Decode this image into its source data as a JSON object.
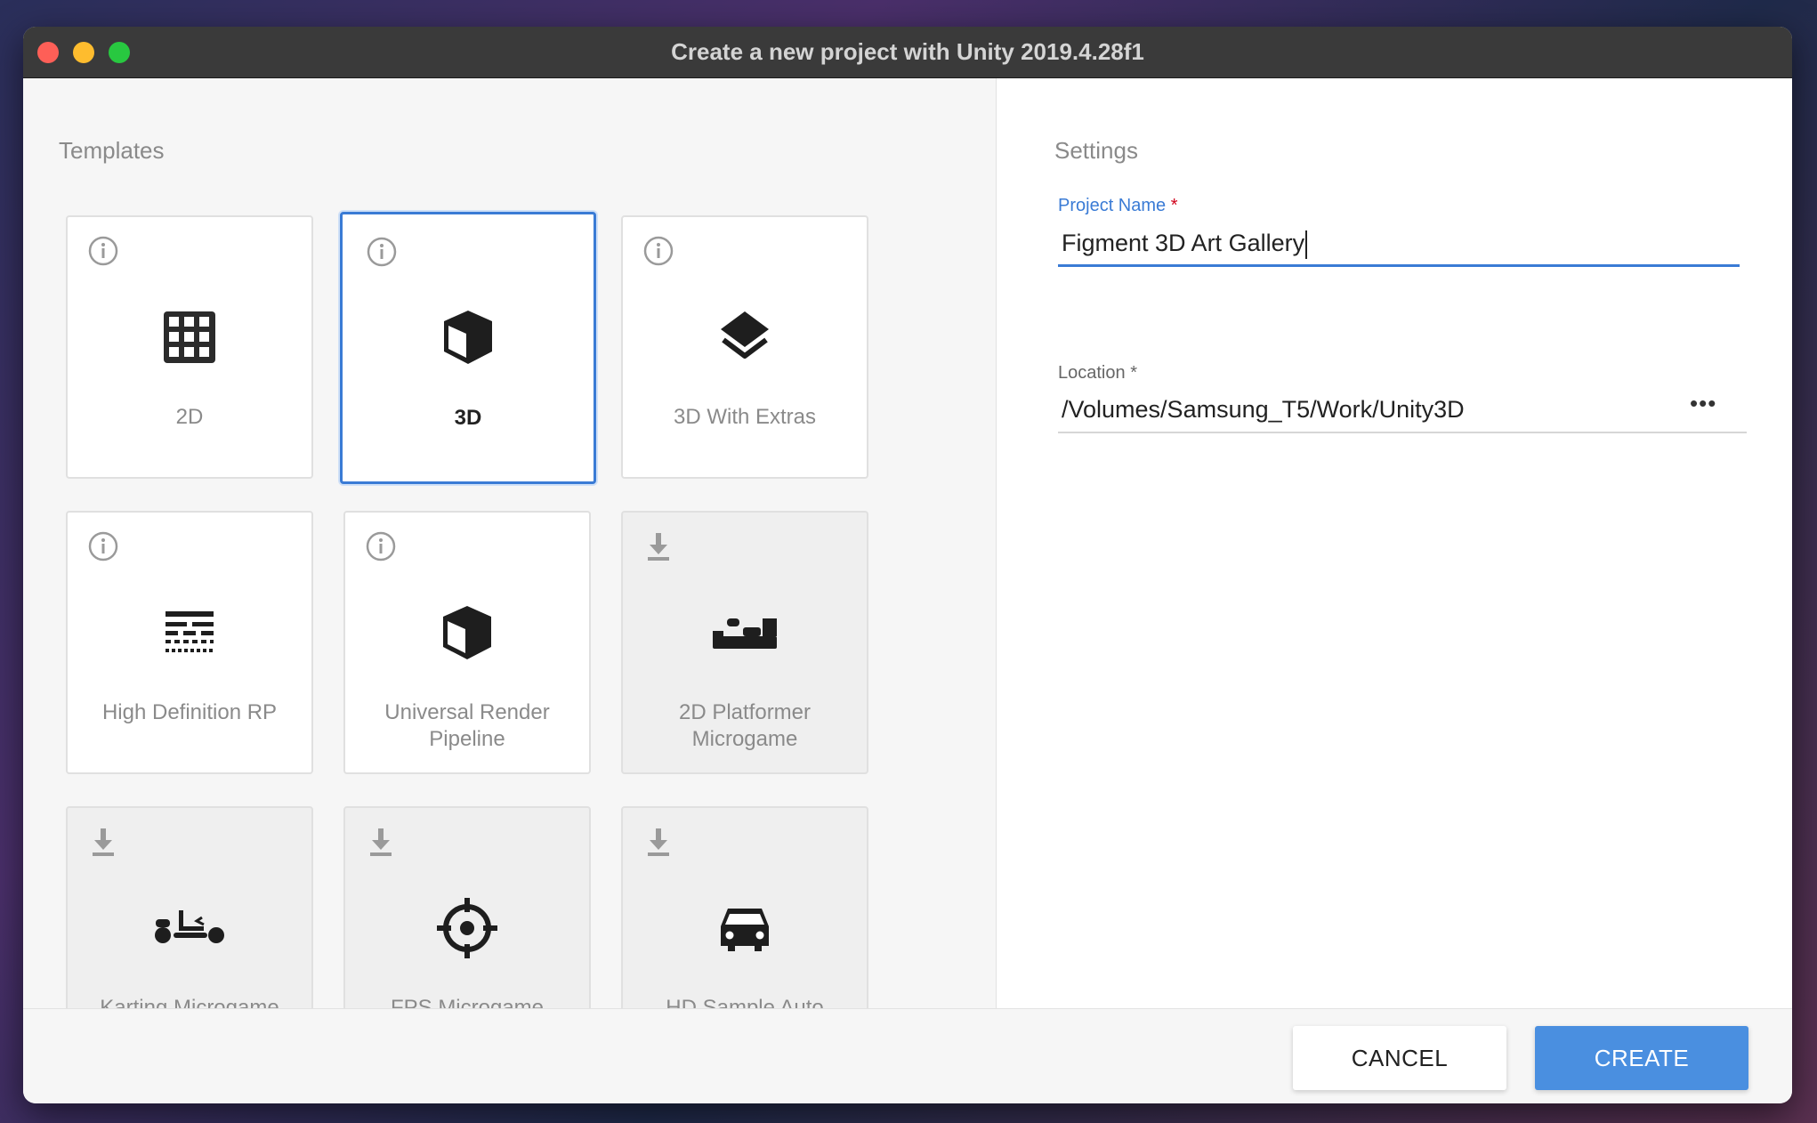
{
  "window": {
    "title": "Create a new project with Unity 2019.4.28f1"
  },
  "templates": {
    "heading": "Templates",
    "items": [
      {
        "label": "2D",
        "icon": "grid-icon",
        "corner": "info-icon",
        "state": "available"
      },
      {
        "label": "3D",
        "icon": "cube-icon",
        "corner": "info-icon",
        "state": "selected"
      },
      {
        "label": "3D With Extras",
        "icon": "layers-icon",
        "corner": "info-icon",
        "state": "available"
      },
      {
        "label": "High Definition RP",
        "icon": "hdrp-icon",
        "corner": "info-icon",
        "state": "available"
      },
      {
        "label": "Universal Render Pipeline",
        "icon": "cube-icon",
        "corner": "info-icon",
        "state": "available"
      },
      {
        "label": "2D Platformer Microgame",
        "icon": "platformer-icon",
        "corner": "download-icon",
        "state": "download"
      },
      {
        "label": "Karting Microgame",
        "icon": "karting-icon",
        "corner": "download-icon",
        "state": "download"
      },
      {
        "label": "FPS Microgame",
        "icon": "crosshair-icon",
        "corner": "download-icon",
        "state": "download"
      },
      {
        "label": "HD Sample Auto Showroom",
        "icon": "car-icon",
        "corner": "download-icon",
        "state": "download"
      }
    ]
  },
  "settings": {
    "heading": "Settings",
    "project_name": {
      "label": "Project Name",
      "required": "*",
      "value": "Figment 3D Art Gallery"
    },
    "location": {
      "label": "Location",
      "required": "*",
      "value": "/Volumes/Samsung_T5/Work/Unity3D",
      "browse": "•••"
    }
  },
  "footer": {
    "cancel_label": "CANCEL",
    "create_label": "CREATE"
  },
  "colors": {
    "accent": "#4a8fe0",
    "selected_border": "#3a7bd5",
    "required": "#d0021b"
  }
}
